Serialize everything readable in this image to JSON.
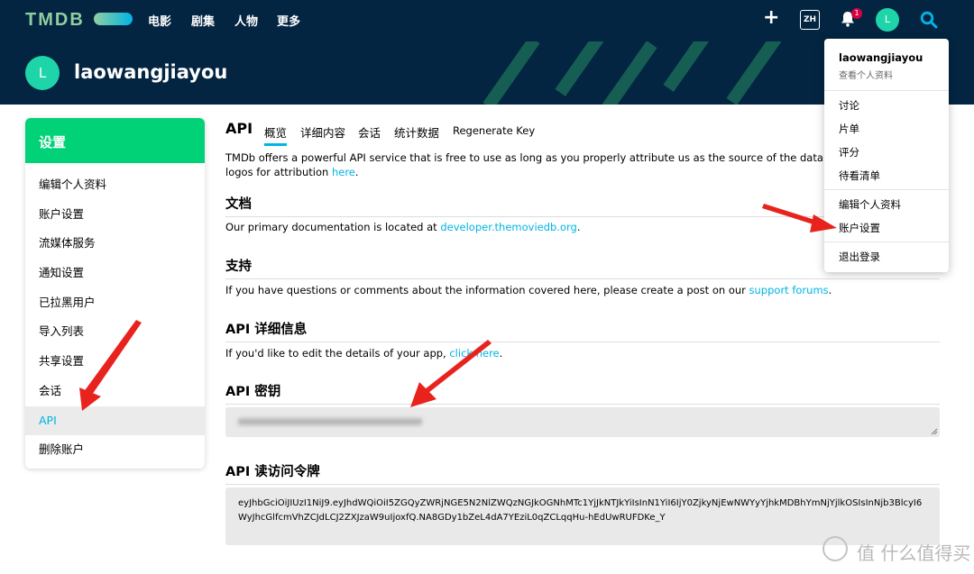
{
  "nav": {
    "logo": "TMDB",
    "links": [
      "电影",
      "剧集",
      "人物",
      "更多"
    ],
    "plus": "+",
    "lang": "ZH",
    "bell_badge": "1",
    "avatar_letter": "L"
  },
  "header": {
    "avatar_letter": "L",
    "username": "laowangjiayou"
  },
  "sidebar": {
    "title": "设置",
    "items": [
      "编辑个人资料",
      "账户设置",
      "流媒体服务",
      "通知设置",
      "已拉黑用户",
      "导入列表",
      "共享设置",
      "会话",
      "API",
      "删除账户"
    ],
    "active_index": 8
  },
  "main": {
    "title": "API",
    "tabs": [
      "概览",
      "详细内容",
      "会话",
      "统计数据",
      "Regenerate Key"
    ],
    "intro_text": "TMDb offers a powerful API service that is free to use as long as you properly attribute us as the source of the data and/or images yo",
    "intro_text2": "logos for attribution ",
    "intro_link": "here",
    "intro_end": ".",
    "docs": {
      "title": "文档",
      "text": "Our primary documentation is located at ",
      "link": "developer.themoviedb.org",
      "end": "."
    },
    "support": {
      "title": "支持",
      "text": "If you have questions or comments about the information covered here, please create a post on our ",
      "link": "support forums",
      "end": "."
    },
    "details": {
      "title": "API 详细信息",
      "text": "If you'd like to edit the details of your app, ",
      "link": "click here",
      "end": "."
    },
    "api_key": {
      "title": "API 密钥"
    },
    "token": {
      "title": "API 读访问令牌",
      "value": "eyJhbGciOiJIUzI1NiJ9.eyJhdWQiOiI5ZGQyZWRjNGE5N2NlZWQzNGJkOGNhMTc1YjJkNTJkYiIsInN1YiI6IjY0ZjkyNjEwNWYyYjhkMDBhYmNjYjlkOSIsInNjb3BlcyI6WyJhcGlfcmVhZCJdLCJ2ZXJzaW9uIjoxfQ.NA8GDy1bZeL4dA7YEziL0qZCLqqHu-hEdUwRUFDKe_Y"
    }
  },
  "dropdown": {
    "username": "laowangjiayou",
    "subtitle": "查看个人资料",
    "group1": [
      "讨论",
      "片单",
      "评分",
      "待看清单"
    ],
    "group2": [
      "编辑个人资料",
      "账户设置"
    ],
    "logout": "退出登录"
  },
  "watermark": "值 什么值得买",
  "colors": {
    "navy": "#032541",
    "green": "#01d277",
    "blue": "#01b4e4",
    "arrow": "#e8231e"
  }
}
